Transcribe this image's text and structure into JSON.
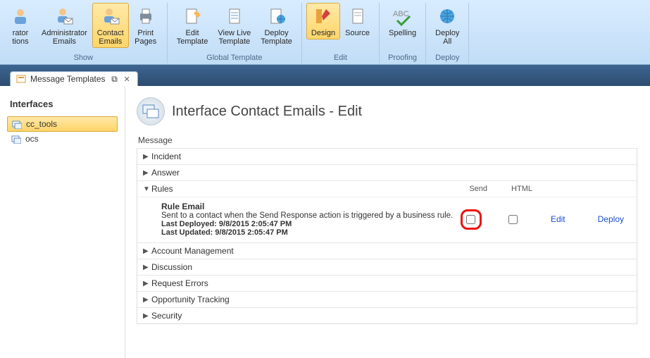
{
  "ribbon": {
    "groups": [
      {
        "label": "Show",
        "buttons": [
          {
            "label": "rator\ntions",
            "partial": true
          },
          {
            "label": "Administrator\nEmails"
          },
          {
            "label": "Contact\nEmails",
            "active": true
          },
          {
            "label": "Print\nPages"
          }
        ]
      },
      {
        "label": "Global Template",
        "buttons": [
          {
            "label": "Edit\nTemplate"
          },
          {
            "label": "View Live\nTemplate"
          },
          {
            "label": "Deploy\nTemplate"
          }
        ]
      },
      {
        "label": "Edit",
        "buttons": [
          {
            "label": "Design",
            "active": true
          },
          {
            "label": "Source"
          }
        ]
      },
      {
        "label": "Proofing",
        "buttons": [
          {
            "label": "Spelling"
          }
        ]
      },
      {
        "label": "Deploy",
        "buttons": [
          {
            "label": "Deploy\nAll"
          }
        ]
      }
    ]
  },
  "tab": {
    "title": "Message Templates"
  },
  "sidebar": {
    "title": "Interfaces",
    "items": [
      {
        "label": "cc_tools",
        "active": true
      },
      {
        "label": "ocs"
      }
    ]
  },
  "page": {
    "title": "Interface Contact Emails - Edit",
    "section": "Message",
    "columns": {
      "send": "Send",
      "html": "HTML"
    },
    "categories": [
      {
        "label": "Incident",
        "expanded": false
      },
      {
        "label": "Answer",
        "expanded": false
      },
      {
        "label": "Rules",
        "expanded": true,
        "item": {
          "title": "Rule Email",
          "desc": "Sent to a contact when the Send Response action is triggered by a business rule.",
          "deployed": "Last Deployed: 9/8/2015 2:05:47 PM",
          "updated": "Last Updated: 9/8/2015 2:05:47 PM",
          "edit": "Edit",
          "deploy": "Deploy"
        }
      },
      {
        "label": "Account Management",
        "expanded": false
      },
      {
        "label": "Discussion",
        "expanded": false
      },
      {
        "label": "Request Errors",
        "expanded": false
      },
      {
        "label": "Opportunity Tracking",
        "expanded": false
      },
      {
        "label": "Security",
        "expanded": false
      }
    ]
  }
}
